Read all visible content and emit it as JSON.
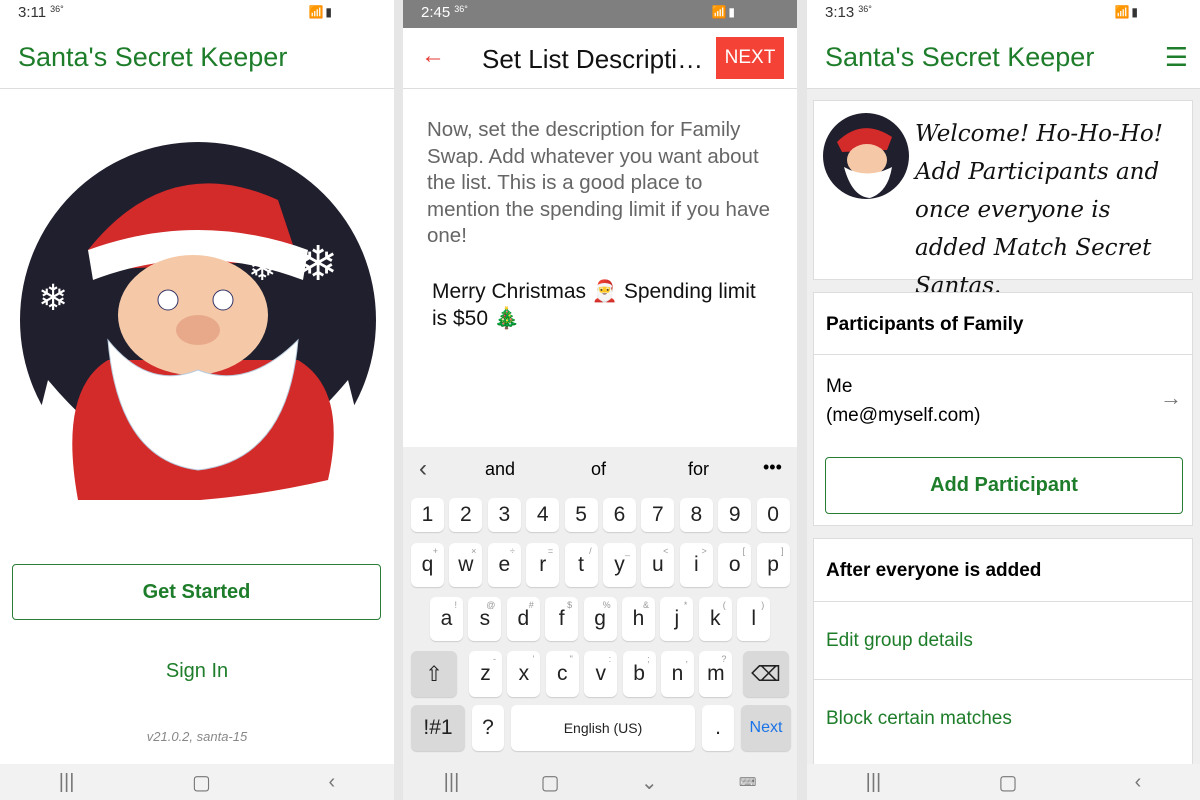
{
  "screen1": {
    "status_time": "3:11",
    "status_temp": "36°",
    "title": "Santa's Secret Keeper",
    "get_started": "Get Started",
    "sign_in": "Sign In",
    "version": "v21.0.2, santa-15"
  },
  "screen2": {
    "status_time": "2:45",
    "status_temp": "36°",
    "title": "Set List Descripti…",
    "next": "NEXT",
    "instructions": "Now, set the description for Family Swap. Add whatever you want about the list. This is a good place to mention the spending limit if you have one!",
    "description_value": "Merry Christmas 🎅 Spending limit is $50 🎄",
    "keyboard": {
      "suggestions": [
        "and",
        "of",
        "for"
      ],
      "numbers": [
        "1",
        "2",
        "3",
        "4",
        "5",
        "6",
        "7",
        "8",
        "9",
        "0"
      ],
      "row1": [
        "q",
        "w",
        "e",
        "r",
        "t",
        "y",
        "u",
        "i",
        "o",
        "p"
      ],
      "row1_alt": [
        "+",
        "×",
        "÷",
        "=",
        "/",
        "_",
        "<",
        ">",
        "[",
        "]"
      ],
      "row2": [
        "a",
        "s",
        "d",
        "f",
        "g",
        "h",
        "j",
        "k",
        "l"
      ],
      "row2_alt": [
        "!",
        "@",
        "#",
        "$",
        "%",
        "&",
        "*",
        "(",
        ")"
      ],
      "row3": [
        "z",
        "x",
        "c",
        "v",
        "b",
        "n",
        "m"
      ],
      "row3_alt": [
        "-",
        "'",
        "\"",
        ":",
        ";",
        ",",
        "?"
      ],
      "symbols": "!#1",
      "question": "?",
      "space": "English (US)",
      "period": ".",
      "action": "Next",
      "action_color": "#1a73e8"
    }
  },
  "screen3": {
    "status_time": "3:13",
    "status_temp": "36°",
    "title": "Santa's Secret Keeper",
    "welcome": "Welcome! Ho-Ho-Ho! Add Participants and once everyone is added Match Secret Santas.",
    "participants_header": "Participants of Family",
    "participant_name": "Me",
    "participant_email": "(me@myself.com)",
    "add_participant": "Add Participant",
    "after_header": "After everyone is added",
    "edit_group": "Edit group details",
    "block_matches": "Block certain matches"
  },
  "colors": {
    "brand_green": "#1e7d2a",
    "accent_red": "#f44336"
  }
}
